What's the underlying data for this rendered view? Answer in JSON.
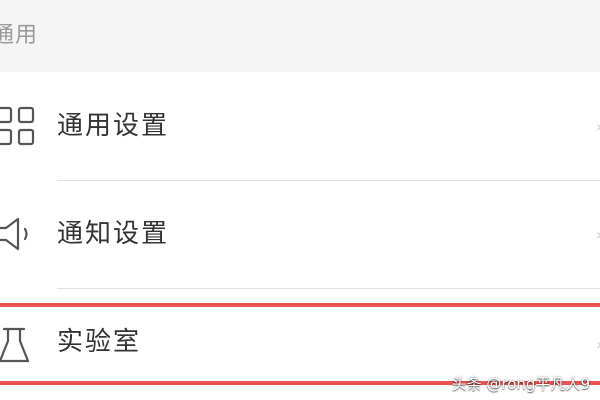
{
  "section": {
    "title": "通用"
  },
  "items": [
    {
      "label": "通用设置",
      "icon": "grid-icon"
    },
    {
      "label": "通知设置",
      "icon": "speaker-icon"
    },
    {
      "label": "实验室",
      "icon": "flask-icon"
    }
  ],
  "watermark": "头条 @rong平凡人9",
  "colors": {
    "section_bg": "#f5f5f5",
    "section_text": "#9a9a9a",
    "label_text": "#333333",
    "icon_stroke": "#555555",
    "divider": "#e2e2e2",
    "highlight": "#e85454"
  }
}
